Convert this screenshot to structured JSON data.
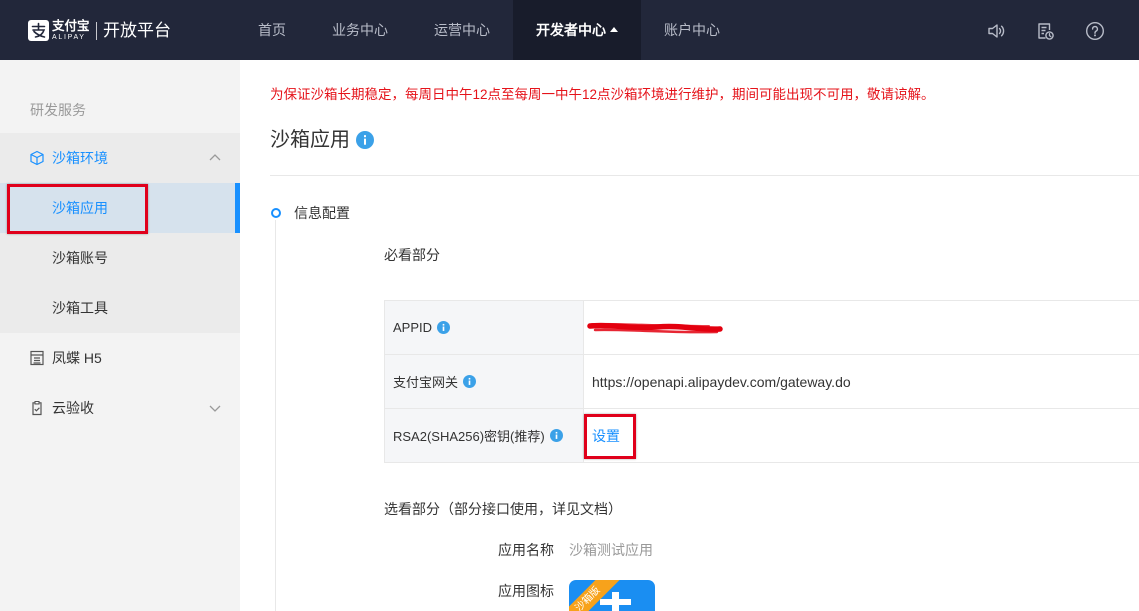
{
  "header": {
    "logo": {
      "cn": "支付宝",
      "en": "ALIPAY"
    },
    "platform": "开放平台",
    "nav": [
      {
        "label": "首页"
      },
      {
        "label": "业务中心"
      },
      {
        "label": "运营中心"
      },
      {
        "label": "开发者中心",
        "active": true
      },
      {
        "label": "账户中心"
      }
    ],
    "right_icons": [
      "speaker-icon",
      "document-clock-icon",
      "help-icon"
    ]
  },
  "sidebar": {
    "section_title": "研发服务",
    "items": [
      {
        "label": "沙箱环境",
        "icon": "cube-icon",
        "expanded": true,
        "children": [
          {
            "label": "沙箱应用",
            "selected": true
          },
          {
            "label": "沙箱账号"
          },
          {
            "label": "沙箱工具"
          }
        ]
      },
      {
        "label": "凤蝶 H5",
        "icon": "layout-icon"
      },
      {
        "label": "云验收",
        "icon": "clipboard-check-icon",
        "expanded": false
      }
    ]
  },
  "main": {
    "notice": "为保证沙箱长期稳定，每周日中午12点至每周一中午12点沙箱环境进行维护，期间可能出现不可用，敬请谅解。",
    "title": "沙箱应用",
    "step": {
      "label": "信息配置"
    },
    "required": {
      "heading": "必看部分",
      "rows": [
        {
          "label": "APPID",
          "redacted": true
        },
        {
          "label": "支付宝网关",
          "value": "https://openapi.alipaydev.com/gateway.do"
        },
        {
          "label": "RSA2(SHA256)密钥(推荐)",
          "action": "设置"
        }
      ]
    },
    "optional": {
      "heading": "选看部分（部分接口使用，详见文档）",
      "fields": [
        {
          "label": "应用名称",
          "value": "沙箱测试应用"
        },
        {
          "label": "应用图标",
          "badge": "沙箱版"
        }
      ]
    }
  },
  "colors": {
    "header_bg": "#22273a",
    "accent": "#1890ff",
    "notice": "#e5131a",
    "annotation": "#e0001b",
    "info": "#3ba1e8"
  }
}
